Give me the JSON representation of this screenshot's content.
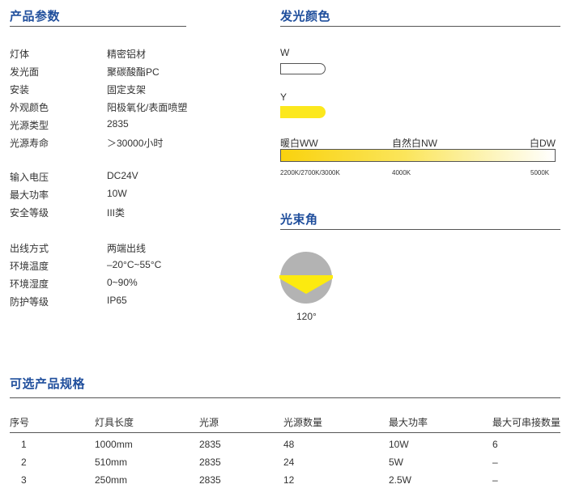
{
  "params": {
    "title": "产品参数",
    "rows": [
      {
        "k": "灯体",
        "v": "精密铝材"
      },
      {
        "k": "发光面",
        "v": "聚碳酸酯PC"
      },
      {
        "k": "安装",
        "v": "固定支架"
      },
      {
        "k": "外观颜色",
        "v": "阳极氧化/表面喷塑"
      },
      {
        "k": "光源类型",
        "v": "2835"
      },
      {
        "k": "光源寿命",
        "v": "＞30000小时"
      },
      {
        "k": "输入电压",
        "v": "DC24V"
      },
      {
        "k": "最大功率",
        "v": "10W"
      },
      {
        "k": "安全等级",
        "v": "III类"
      },
      {
        "k": "出线方式",
        "v": "两端出线"
      },
      {
        "k": "环境温度",
        "v": "–20°C~55°C"
      },
      {
        "k": "环境湿度",
        "v": "0~90%"
      },
      {
        "k": "防护等级",
        "v": "IP65"
      }
    ]
  },
  "color": {
    "title": "发光颜色",
    "w_label": "W",
    "y_label": "Y",
    "ww": "暖白WW",
    "nw": "自然白NW",
    "dw": "白DW",
    "t1": "2200K/2700K/3000K",
    "t2": "4000K",
    "t3": "5000K",
    "yellow": "#fce81d"
  },
  "beam": {
    "title": "光束角",
    "angle": "120°",
    "angle_deg": 120,
    "gray": "#b3b3b3",
    "yellow": "#fcea0f"
  },
  "options": {
    "title": "可选产品规格",
    "headers": [
      "序号",
      "灯具长度",
      "光源",
      "光源数量",
      "最大功率",
      "最大可串接数量"
    ],
    "rows": [
      [
        "1",
        "1000mm",
        "2835",
        "48",
        "10W",
        "6"
      ],
      [
        "2",
        "510mm",
        "2835",
        "24",
        "5W",
        "–"
      ],
      [
        "3",
        "250mm",
        "2835",
        "12",
        "2.5W",
        "–"
      ]
    ]
  }
}
